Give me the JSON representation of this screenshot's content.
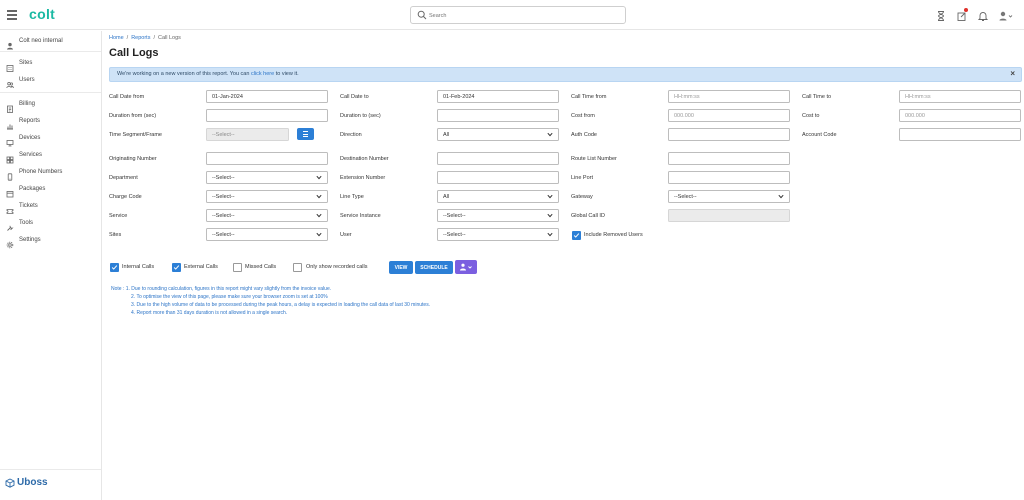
{
  "header": {
    "logo": "colt",
    "search_placeholder": "Search"
  },
  "sidebar": {
    "account": "Colt neo internal",
    "items": [
      {
        "label": "Sites",
        "icon": "building-icon"
      },
      {
        "label": "Users",
        "icon": "users-icon"
      },
      {
        "label": "Billing",
        "icon": "billing-icon"
      },
      {
        "label": "Reports",
        "icon": "reports-icon"
      },
      {
        "label": "Devices",
        "icon": "devices-icon"
      },
      {
        "label": "Services",
        "icon": "services-icon"
      },
      {
        "label": "Phone Numbers",
        "icon": "phone-icon"
      },
      {
        "label": "Packages",
        "icon": "packages-icon"
      },
      {
        "label": "Tickets",
        "icon": "tickets-icon"
      },
      {
        "label": "Tools",
        "icon": "tools-icon"
      },
      {
        "label": "Settings",
        "icon": "gear-icon"
      }
    ],
    "brand": "Uboss"
  },
  "breadcrumb": {
    "home": "Home",
    "reports": "Reports",
    "current": "Call Logs",
    "sep": "/"
  },
  "page": {
    "title": "Call Logs"
  },
  "alert": {
    "text_before": "We're working on a new version of this report. You can",
    "link": "click here",
    "text_after": "to view it.",
    "close": "×"
  },
  "form": {
    "call_date_from": {
      "label": "Call Date from",
      "value": "01-Jan-2024"
    },
    "call_date_to": {
      "label": "Call Date to",
      "value": "01-Feb-2024"
    },
    "call_time_from": {
      "label": "Call Time from",
      "placeholder": "HH:mm:ss"
    },
    "call_time_to": {
      "label": "Call Time to",
      "placeholder": "HH:mm:ss"
    },
    "duration_from": {
      "label": "Duration from (sec)",
      "value": ""
    },
    "duration_to": {
      "label": "Duration to (sec)",
      "value": ""
    },
    "cost_from": {
      "label": "Cost from",
      "placeholder": "000.000"
    },
    "cost_to": {
      "label": "Cost to",
      "placeholder": "000.000"
    },
    "time_segment": {
      "label": "Time Segment/Frame",
      "value": "--Select--"
    },
    "direction": {
      "label": "Direction",
      "value": "All"
    },
    "auth_code": {
      "label": "Auth Code",
      "value": ""
    },
    "account_code": {
      "label": "Account Code",
      "value": ""
    },
    "originating_number": {
      "label": "Originating Number",
      "value": ""
    },
    "destination_number": {
      "label": "Destination Number",
      "value": ""
    },
    "route_list_number": {
      "label": "Route List Number",
      "value": ""
    },
    "department": {
      "label": "Department",
      "value": "--Select--"
    },
    "extension_number": {
      "label": "Extension Number",
      "value": ""
    },
    "line_port": {
      "label": "Line Port",
      "value": ""
    },
    "charge_code": {
      "label": "Charge Code",
      "value": "--Select--"
    },
    "line_type": {
      "label": "Line Type",
      "value": "All"
    },
    "gateway": {
      "label": "Gateway",
      "value": "--Select--"
    },
    "service": {
      "label": "Service",
      "value": "--Select--"
    },
    "service_instance": {
      "label": "Service Instance",
      "value": "--Select--"
    },
    "global_call_id": {
      "label": "Global Call ID",
      "value": ""
    },
    "sites": {
      "label": "Sites",
      "value": "--Select--"
    },
    "user": {
      "label": "User",
      "value": "--Select--"
    },
    "include_removed_users": {
      "label": "Include Removed Users",
      "checked": true
    }
  },
  "filters": {
    "internal_calls": {
      "label": "Internal Calls",
      "checked": true
    },
    "external_calls": {
      "label": "External Calls",
      "checked": true
    },
    "missed_calls": {
      "label": "Missed Calls",
      "checked": false
    },
    "recorded_calls": {
      "label": "Only show recorded calls",
      "checked": false
    }
  },
  "actions": {
    "view": "VIEW",
    "schedule": "SCHEDULE",
    "export_icon": "person-download-icon"
  },
  "notes": [
    "Note : 1. Due to rounding calculation, figures in this report might vary slightly from the invoice value.",
    "2. To optimise the view of this page, please make sure your browser zoom is set at 100%",
    "3. Due to the high volume of data to be processed during the peak hours, a delay is expected in loading the call data of last 30 minutes.",
    "4. Report more than 31 days duration is not allowed in a single search."
  ],
  "colors": {
    "brand": "#1bb9a3",
    "primary": "#2c7fd6",
    "purple": "#7b5fe0",
    "alert_bg": "#cfe3f7",
    "note_text": "#2c74c7"
  }
}
